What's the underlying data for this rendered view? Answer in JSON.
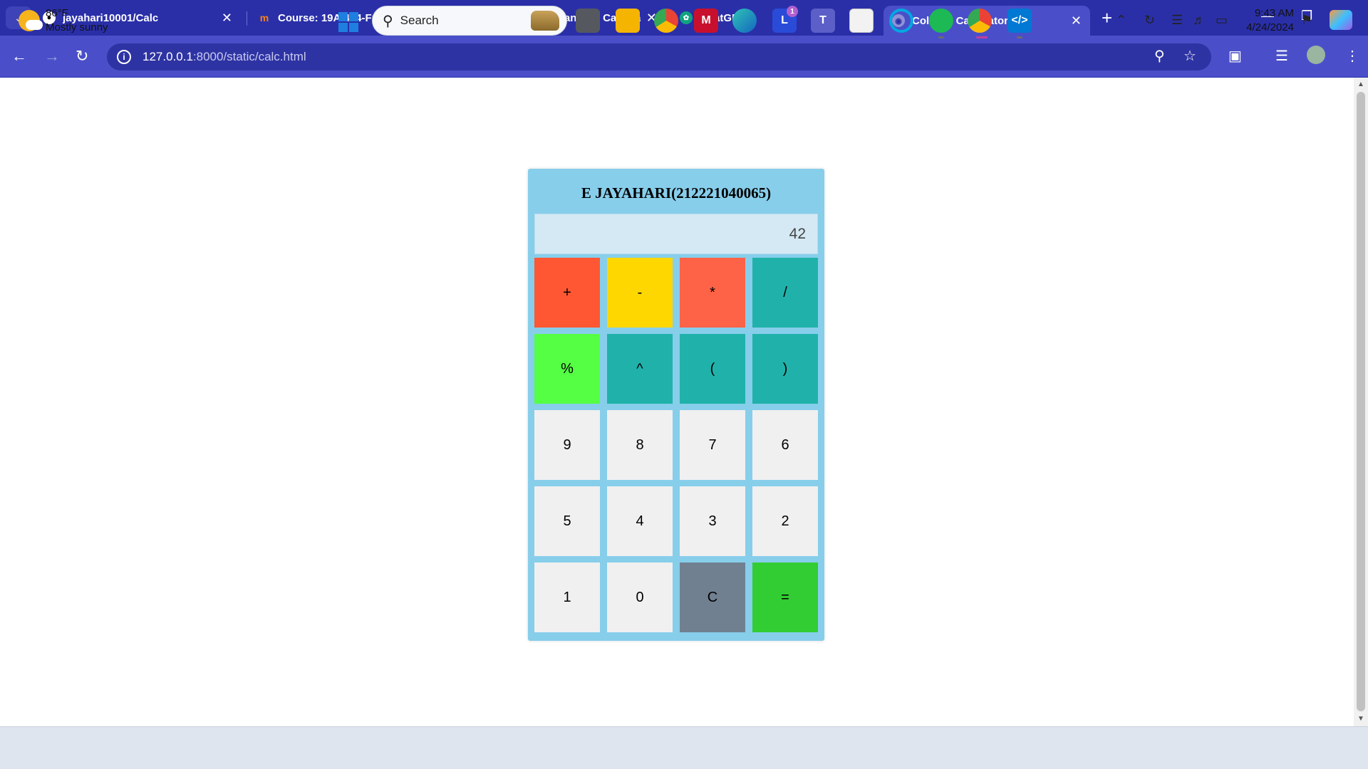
{
  "browser": {
    "tabs": [
      {
        "title": "jayahari10001/Calc",
        "icon": "github-icon"
      },
      {
        "title": "Course: 19AI414-Fundamentals",
        "icon": "moodle-icon"
      },
      {
        "title": "(1849) Ex 08 Standard Calculato",
        "icon": "youtube-icon"
      },
      {
        "title": "ChatGPT",
        "icon": "chatgpt-icon"
      },
      {
        "title": "Colorful Calculator",
        "icon": "globe-icon"
      }
    ],
    "active_tab_index": 4,
    "url_host": "127.0.0.1",
    "url_rest": ":8000/static/calc.html",
    "colors": {
      "tabstrip": "#2a2fa8",
      "toolbar": "#4a4fc9"
    }
  },
  "calculator": {
    "title": "E JAYAHARI(212221040065)",
    "display_value": "42",
    "background": "#87ceeb",
    "keys": [
      {
        "label": "+",
        "color": "#ff5733"
      },
      {
        "label": "-",
        "color": "#ffd700"
      },
      {
        "label": "*",
        "color": "#ff6347"
      },
      {
        "label": "/",
        "color": "#20b2aa"
      },
      {
        "label": "%",
        "color": "#55ff44"
      },
      {
        "label": "^",
        "color": "#20b2aa"
      },
      {
        "label": "(",
        "color": "#20b2aa"
      },
      {
        "label": ")",
        "color": "#20b2aa"
      },
      {
        "label": "9",
        "color": "#f0f0f0"
      },
      {
        "label": "8",
        "color": "#f0f0f0"
      },
      {
        "label": "7",
        "color": "#f0f0f0"
      },
      {
        "label": "6",
        "color": "#f0f0f0"
      },
      {
        "label": "5",
        "color": "#f0f0f0"
      },
      {
        "label": "4",
        "color": "#f0f0f0"
      },
      {
        "label": "3",
        "color": "#f0f0f0"
      },
      {
        "label": "2",
        "color": "#f0f0f0"
      },
      {
        "label": "1",
        "color": "#f0f0f0"
      },
      {
        "label": "0",
        "color": "#f0f0f0"
      },
      {
        "label": "C",
        "color": "#708090"
      },
      {
        "label": "=",
        "color": "#32cd32"
      }
    ]
  },
  "taskbar": {
    "weather_temp": "86°F",
    "weather_desc": "Mostly sunny",
    "search_label": "Search",
    "teams_badge": "1",
    "time": "9:43 AM",
    "date": "4/24/2024"
  }
}
